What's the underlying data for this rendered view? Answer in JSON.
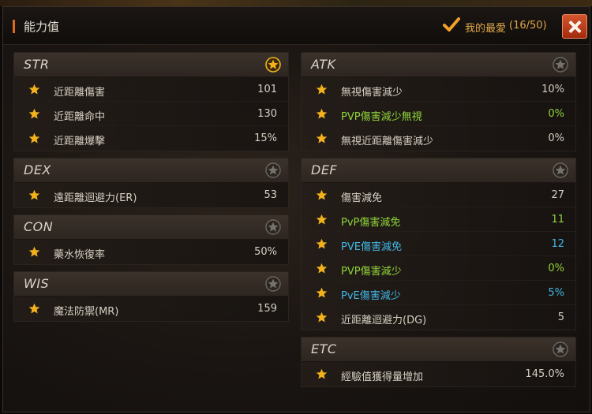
{
  "window": {
    "title": "能力值",
    "favorites_label": "我的最愛",
    "favorites_count": "(16/50)"
  },
  "colors": {
    "accent": "#d96a1f",
    "close": "#b8391a",
    "star_active": "#f3b21c",
    "star_inactive": "#6b6662",
    "green_text": "#8fd43a",
    "blue_text": "#3fb7e6"
  },
  "groups": {
    "str": {
      "name": "STR",
      "favorite": true,
      "rows": [
        {
          "label": "近距離傷害",
          "value": "101"
        },
        {
          "label": "近距離命中",
          "value": "130"
        },
        {
          "label": "近距離爆擊",
          "value": "15%"
        }
      ]
    },
    "dex": {
      "name": "DEX",
      "favorite": false,
      "rows": [
        {
          "label": "遠距離迴避力(ER)",
          "value": "53"
        }
      ]
    },
    "con": {
      "name": "CON",
      "favorite": false,
      "rows": [
        {
          "label": "藥水恢復率",
          "value": "50%"
        }
      ]
    },
    "wis": {
      "name": "WIS",
      "favorite": false,
      "rows": [
        {
          "label": "魔法防禦(MR)",
          "value": "159"
        }
      ]
    },
    "atk": {
      "name": "ATK",
      "favorite": false,
      "rows": [
        {
          "label": "無視傷害減少",
          "value": "10%"
        },
        {
          "label": "PVP傷害減少無視",
          "value": "0%"
        },
        {
          "label": "無視近距離傷害減少",
          "value": "0%"
        }
      ]
    },
    "def": {
      "name": "DEF",
      "favorite": false,
      "rows": [
        {
          "label": "傷害減免",
          "value": "27"
        },
        {
          "label": "PvP傷害減免",
          "value": "11"
        },
        {
          "label": "PVE傷害減免",
          "value": "12"
        },
        {
          "label": "PVP傷害減少",
          "value": "0%"
        },
        {
          "label": "PvE傷害減少",
          "value": "5%"
        },
        {
          "label": "近距離迴避力(DG)",
          "value": "5"
        }
      ]
    },
    "etc": {
      "name": "ETC",
      "favorite": false,
      "rows": [
        {
          "label": "經驗值獲得量增加",
          "value": "145.0%"
        }
      ]
    }
  }
}
